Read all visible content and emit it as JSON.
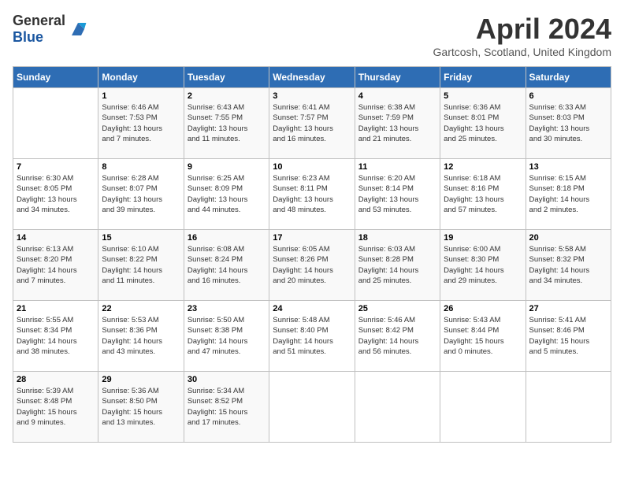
{
  "header": {
    "logo_general": "General",
    "logo_blue": "Blue",
    "month_title": "April 2024",
    "location": "Gartcosh, Scotland, United Kingdom"
  },
  "days_of_week": [
    "Sunday",
    "Monday",
    "Tuesday",
    "Wednesday",
    "Thursday",
    "Friday",
    "Saturday"
  ],
  "weeks": [
    [
      {
        "day": "",
        "info": ""
      },
      {
        "day": "1",
        "info": "Sunrise: 6:46 AM\nSunset: 7:53 PM\nDaylight: 13 hours\nand 7 minutes."
      },
      {
        "day": "2",
        "info": "Sunrise: 6:43 AM\nSunset: 7:55 PM\nDaylight: 13 hours\nand 11 minutes."
      },
      {
        "day": "3",
        "info": "Sunrise: 6:41 AM\nSunset: 7:57 PM\nDaylight: 13 hours\nand 16 minutes."
      },
      {
        "day": "4",
        "info": "Sunrise: 6:38 AM\nSunset: 7:59 PM\nDaylight: 13 hours\nand 21 minutes."
      },
      {
        "day": "5",
        "info": "Sunrise: 6:36 AM\nSunset: 8:01 PM\nDaylight: 13 hours\nand 25 minutes."
      },
      {
        "day": "6",
        "info": "Sunrise: 6:33 AM\nSunset: 8:03 PM\nDaylight: 13 hours\nand 30 minutes."
      }
    ],
    [
      {
        "day": "7",
        "info": "Sunrise: 6:30 AM\nSunset: 8:05 PM\nDaylight: 13 hours\nand 34 minutes."
      },
      {
        "day": "8",
        "info": "Sunrise: 6:28 AM\nSunset: 8:07 PM\nDaylight: 13 hours\nand 39 minutes."
      },
      {
        "day": "9",
        "info": "Sunrise: 6:25 AM\nSunset: 8:09 PM\nDaylight: 13 hours\nand 44 minutes."
      },
      {
        "day": "10",
        "info": "Sunrise: 6:23 AM\nSunset: 8:11 PM\nDaylight: 13 hours\nand 48 minutes."
      },
      {
        "day": "11",
        "info": "Sunrise: 6:20 AM\nSunset: 8:14 PM\nDaylight: 13 hours\nand 53 minutes."
      },
      {
        "day": "12",
        "info": "Sunrise: 6:18 AM\nSunset: 8:16 PM\nDaylight: 13 hours\nand 57 minutes."
      },
      {
        "day": "13",
        "info": "Sunrise: 6:15 AM\nSunset: 8:18 PM\nDaylight: 14 hours\nand 2 minutes."
      }
    ],
    [
      {
        "day": "14",
        "info": "Sunrise: 6:13 AM\nSunset: 8:20 PM\nDaylight: 14 hours\nand 7 minutes."
      },
      {
        "day": "15",
        "info": "Sunrise: 6:10 AM\nSunset: 8:22 PM\nDaylight: 14 hours\nand 11 minutes."
      },
      {
        "day": "16",
        "info": "Sunrise: 6:08 AM\nSunset: 8:24 PM\nDaylight: 14 hours\nand 16 minutes."
      },
      {
        "day": "17",
        "info": "Sunrise: 6:05 AM\nSunset: 8:26 PM\nDaylight: 14 hours\nand 20 minutes."
      },
      {
        "day": "18",
        "info": "Sunrise: 6:03 AM\nSunset: 8:28 PM\nDaylight: 14 hours\nand 25 minutes."
      },
      {
        "day": "19",
        "info": "Sunrise: 6:00 AM\nSunset: 8:30 PM\nDaylight: 14 hours\nand 29 minutes."
      },
      {
        "day": "20",
        "info": "Sunrise: 5:58 AM\nSunset: 8:32 PM\nDaylight: 14 hours\nand 34 minutes."
      }
    ],
    [
      {
        "day": "21",
        "info": "Sunrise: 5:55 AM\nSunset: 8:34 PM\nDaylight: 14 hours\nand 38 minutes."
      },
      {
        "day": "22",
        "info": "Sunrise: 5:53 AM\nSunset: 8:36 PM\nDaylight: 14 hours\nand 43 minutes."
      },
      {
        "day": "23",
        "info": "Sunrise: 5:50 AM\nSunset: 8:38 PM\nDaylight: 14 hours\nand 47 minutes."
      },
      {
        "day": "24",
        "info": "Sunrise: 5:48 AM\nSunset: 8:40 PM\nDaylight: 14 hours\nand 51 minutes."
      },
      {
        "day": "25",
        "info": "Sunrise: 5:46 AM\nSunset: 8:42 PM\nDaylight: 14 hours\nand 56 minutes."
      },
      {
        "day": "26",
        "info": "Sunrise: 5:43 AM\nSunset: 8:44 PM\nDaylight: 15 hours\nand 0 minutes."
      },
      {
        "day": "27",
        "info": "Sunrise: 5:41 AM\nSunset: 8:46 PM\nDaylight: 15 hours\nand 5 minutes."
      }
    ],
    [
      {
        "day": "28",
        "info": "Sunrise: 5:39 AM\nSunset: 8:48 PM\nDaylight: 15 hours\nand 9 minutes."
      },
      {
        "day": "29",
        "info": "Sunrise: 5:36 AM\nSunset: 8:50 PM\nDaylight: 15 hours\nand 13 minutes."
      },
      {
        "day": "30",
        "info": "Sunrise: 5:34 AM\nSunset: 8:52 PM\nDaylight: 15 hours\nand 17 minutes."
      },
      {
        "day": "",
        "info": ""
      },
      {
        "day": "",
        "info": ""
      },
      {
        "day": "",
        "info": ""
      },
      {
        "day": "",
        "info": ""
      }
    ]
  ]
}
